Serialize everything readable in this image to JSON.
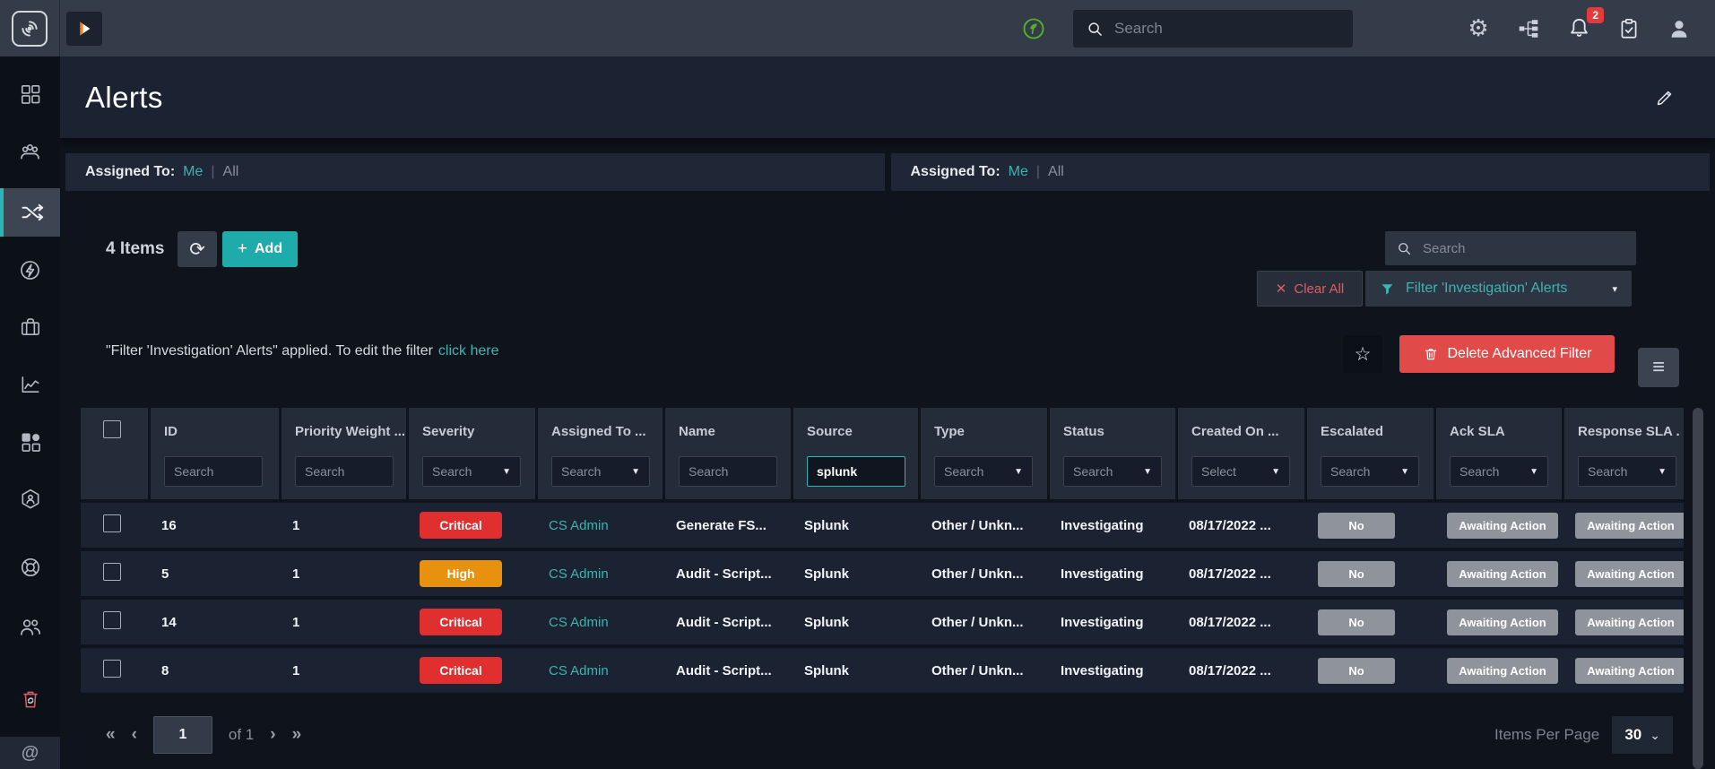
{
  "topbar": {
    "search_placeholder": "Search",
    "notification_count": "2",
    "icon_names": [
      "health-status-icon",
      "search-icon",
      "gear-icon",
      "hierarchy-icon",
      "bell-icon",
      "clipboard-check-icon",
      "user-icon"
    ]
  },
  "page": {
    "title": "Alerts"
  },
  "assigned_bar": {
    "label": "Assigned To:",
    "me": "Me",
    "divider": "|",
    "all": "All"
  },
  "toolbar": {
    "items_count": "4 Items",
    "add_label": "Add",
    "search_placeholder": "Search",
    "clear_all_label": "Clear All",
    "filter_label": "Filter 'Investigation' Alerts"
  },
  "filter_banner": {
    "message": "\"Filter 'Investigation' Alerts\" applied. To edit the filter",
    "link": "click here",
    "delete_label": "Delete Advanced Filter"
  },
  "table": {
    "columns": [
      {
        "label": "ID",
        "filter": "text",
        "placeholder": "Search"
      },
      {
        "label": "Priority Weight ...",
        "filter": "text",
        "placeholder": "Search"
      },
      {
        "label": "Severity",
        "filter": "select",
        "placeholder": "Search"
      },
      {
        "label": "Assigned To  ...",
        "filter": "select",
        "placeholder": "Search"
      },
      {
        "label": "Name",
        "filter": "text",
        "placeholder": "Search"
      },
      {
        "label": "Source",
        "filter": "text",
        "value": "splunk"
      },
      {
        "label": "Type",
        "filter": "select",
        "placeholder": "Search"
      },
      {
        "label": "Status",
        "filter": "select",
        "placeholder": "Search"
      },
      {
        "label": "Created On  ...",
        "filter": "select",
        "placeholder": "Select"
      },
      {
        "label": "Escalated",
        "filter": "select",
        "placeholder": "Search"
      },
      {
        "label": "Ack SLA",
        "filter": "select",
        "placeholder": "Search"
      },
      {
        "label": "Response SLA .",
        "filter": "select",
        "placeholder": "Search"
      }
    ],
    "rows": [
      {
        "id": "16",
        "priority_weight": "1",
        "severity": "Critical",
        "severity_color": "#e12f2f",
        "assigned_to": "CS Admin",
        "name": "Generate FS...",
        "source": "Splunk",
        "type": "Other / Unkn...",
        "status": "Investigating",
        "created_on": "08/17/2022 ...",
        "escalated": "No",
        "ack_sla": "Awaiting Action",
        "response_sla": "Awaiting Action"
      },
      {
        "id": "5",
        "priority_weight": "1",
        "severity": "High",
        "severity_color": "#e8910e",
        "assigned_to": "CS Admin",
        "name": "Audit - Script...",
        "source": "Splunk",
        "type": "Other / Unkn...",
        "status": "Investigating",
        "created_on": "08/17/2022 ...",
        "escalated": "No",
        "ack_sla": "Awaiting Action",
        "response_sla": "Awaiting Action"
      },
      {
        "id": "14",
        "priority_weight": "1",
        "severity": "Critical",
        "severity_color": "#e12f2f",
        "assigned_to": "CS Admin",
        "name": "Audit - Script...",
        "source": "Splunk",
        "type": "Other / Unkn...",
        "status": "Investigating",
        "created_on": "08/17/2022 ...",
        "escalated": "No",
        "ack_sla": "Awaiting Action",
        "response_sla": "Awaiting Action"
      },
      {
        "id": "8",
        "priority_weight": "1",
        "severity": "Critical",
        "severity_color": "#e12f2f",
        "assigned_to": "CS Admin",
        "name": "Audit - Script...",
        "source": "Splunk",
        "type": "Other / Unkn...",
        "status": "Investigating",
        "created_on": "08/17/2022 ...",
        "escalated": "No",
        "ack_sla": "Awaiting Action",
        "response_sla": "Awaiting Action"
      }
    ]
  },
  "pagination": {
    "page_value": "1",
    "of_label": "of 1",
    "items_per_page_label": "Items Per Page",
    "items_per_page_value": "30"
  },
  "sidebar": {
    "icon_names": [
      "app-logo-icon",
      "play-expand-icon",
      "dashboards-icon",
      "teams-icon",
      "workflow-shuffle-icon",
      "automation-lightning-icon",
      "cases-briefcase-icon",
      "reports-chart-icon",
      "applications-grid-icon",
      "integrations-hexagon-icon",
      "support-lifebuoy-icon",
      "users-icon",
      "recycle-bin-icon",
      "at-sign-icon"
    ],
    "active_item": "workflow"
  },
  "icons": {
    "first_page": "«",
    "previous_page": "‹",
    "next_page": "›",
    "last_page": "»",
    "menu": "≡",
    "star": "☆",
    "refresh": "⟳",
    "close": "✕",
    "plus": "+",
    "caret_down": "▾",
    "select_caret": "▼",
    "chevron_down": "⌄",
    "gear": "⚙",
    "at_sign": "@"
  },
  "colors": {
    "accent_teal": "#3cb4b0",
    "add_button": "#20abab",
    "critical": "#e12f2f",
    "high": "#e8910e",
    "delete_red": "#e24a4a",
    "badge_gray": "#8f939b",
    "notification_red": "#e23b3b",
    "status_green": "#56b127"
  }
}
